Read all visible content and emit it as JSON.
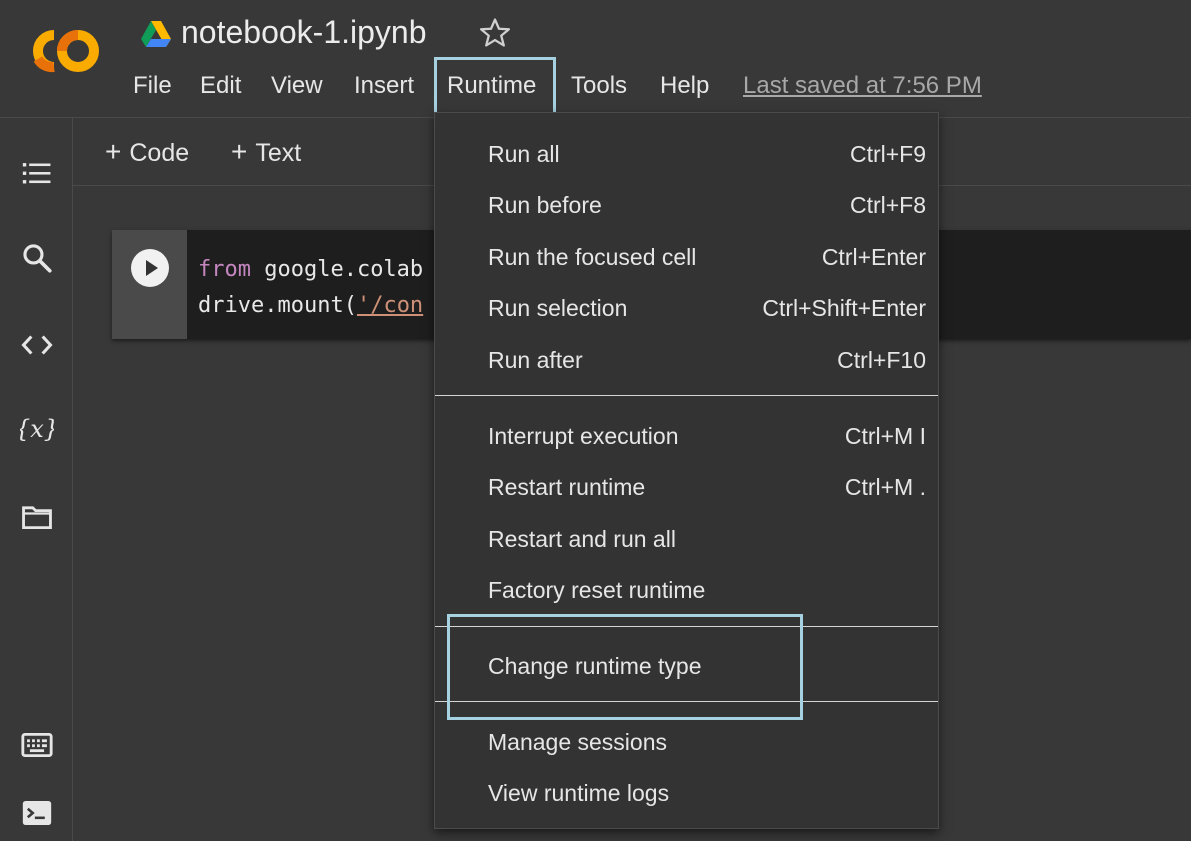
{
  "app": {
    "logo": "CO",
    "title": "notebook-1.ipynb"
  },
  "icons": {
    "logo": "colab-logo-icon",
    "drive": "google-drive-icon",
    "star": "star-outline-icon",
    "toc": "table-of-contents-icon",
    "search": "search-icon",
    "code": "code-snippets-icon",
    "variables": "variables-icon",
    "files": "folder-icon",
    "command_palette": "command-palette-icon",
    "terminal": "terminal-icon",
    "run": "play-icon"
  },
  "menubar": {
    "items": [
      "File",
      "Edit",
      "View",
      "Insert",
      "Runtime",
      "Tools",
      "Help"
    ],
    "last_saved": "Last saved at 7:56 PM"
  },
  "toolbar": {
    "add_code": "Code",
    "add_text": "Text",
    "plus": "+"
  },
  "cell": {
    "line1_kw": "from",
    "line1_rest": " google.colab",
    "line2_pre": "drive.mount(",
    "line2_str": "'/con"
  },
  "runtime_menu": {
    "items": [
      {
        "label": "Run all",
        "shortcut": "Ctrl+F9"
      },
      {
        "label": "Run before",
        "shortcut": "Ctrl+F8"
      },
      {
        "label": "Run the focused cell",
        "shortcut": "Ctrl+Enter"
      },
      {
        "label": "Run selection",
        "shortcut": "Ctrl+Shift+Enter"
      },
      {
        "label": "Run after",
        "shortcut": "Ctrl+F10"
      },
      {
        "label": "Interrupt execution",
        "shortcut": "Ctrl+M I"
      },
      {
        "label": "Restart runtime",
        "shortcut": "Ctrl+M ."
      },
      {
        "label": "Restart and run all",
        "shortcut": ""
      },
      {
        "label": "Factory reset runtime",
        "shortcut": ""
      },
      {
        "label": "Change runtime type",
        "shortcut": ""
      },
      {
        "label": "Manage sessions",
        "shortcut": ""
      },
      {
        "label": "View runtime logs",
        "shortcut": ""
      }
    ]
  },
  "colors": {
    "background": "#383838",
    "menu_bg": "#333333",
    "highlight": "#a6d1e0",
    "logo_orange": "#f9ab00",
    "logo_dark_orange": "#e8710a"
  }
}
